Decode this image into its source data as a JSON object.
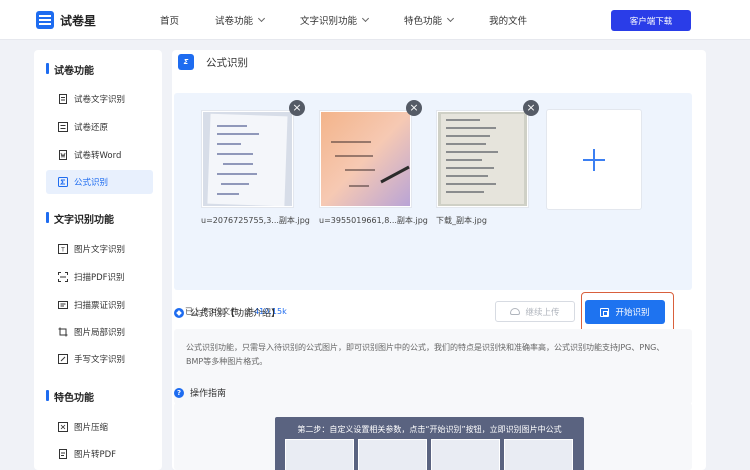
{
  "header": {
    "logo_text": "试卷星",
    "nav": [
      {
        "label": "首页",
        "dropdown": false
      },
      {
        "label": "试卷功能",
        "dropdown": true
      },
      {
        "label": "文字识别功能",
        "dropdown": true
      },
      {
        "label": "特色功能",
        "dropdown": true
      },
      {
        "label": "我的文件",
        "dropdown": false
      }
    ],
    "download_label": "客户端下载"
  },
  "sidebar": {
    "sections": [
      {
        "title": "试卷功能",
        "items": [
          {
            "label": "试卷文字识别"
          },
          {
            "label": "试卷还原"
          },
          {
            "label": "试卷转Word"
          },
          {
            "label": "公式识别",
            "active": true
          }
        ]
      },
      {
        "title": "文字识别功能",
        "items": [
          {
            "label": "图片文字识别"
          },
          {
            "label": "扫描PDF识别"
          },
          {
            "label": "扫描票证识别"
          },
          {
            "label": "图片局部识别"
          },
          {
            "label": "手写文字识别"
          }
        ]
      },
      {
        "title": "特色功能",
        "items": [
          {
            "label": "图片压缩"
          },
          {
            "label": "图片转PDF"
          }
        ]
      }
    ]
  },
  "main": {
    "title_badge": "Σ",
    "title": "公式识别",
    "files": [
      {
        "name": "u=2076725755,3...副本.jpg"
      },
      {
        "name": "u=3955019661,8...副本.jpg"
      },
      {
        "name": "下载_副本.jpg"
      }
    ],
    "status_prefix": "已上传3份文件，共",
    "status_size": "410.15k",
    "continue_label": "继续上传",
    "start_label": "开始识别",
    "info_title": "公式识别【功能介绍】",
    "info_text": "公式识别功能，只需导入待识别的公式图片，即可识别图片中的公式，我们的特点是识别快和准确率高，公式识别功能支持JPG、PNG、BMP等多种图片格式。",
    "guide_title": "操作指南",
    "guide_caption": "第二步：自定义设置相关参数，点击“开始识别”按钮，立即识别图片中公式"
  },
  "colors": {
    "accent": "#1e6cf0",
    "download_button": "#2a3de8",
    "highlight_outline": "#d9603c"
  }
}
